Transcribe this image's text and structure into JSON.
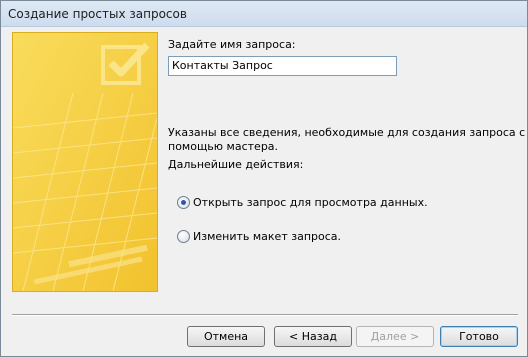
{
  "window": {
    "title": "Создание простых запросов"
  },
  "form": {
    "name_label": "Задайте имя запроса:",
    "name_value": "Контакты Запрос",
    "info_text_line1": "Указаны все сведения, необходимые для создания запроса с",
    "info_text_line2": "помощью мастера.",
    "actions_label": "Дальнейшие действия:",
    "options": [
      {
        "label": "Открыть запрос для просмотра данных.",
        "selected": true
      },
      {
        "label": "Изменить макет запроса.",
        "selected": false
      }
    ]
  },
  "buttons": {
    "cancel": "Отмена",
    "back": "< Назад",
    "next": "Далее >",
    "finish": "Готово"
  }
}
